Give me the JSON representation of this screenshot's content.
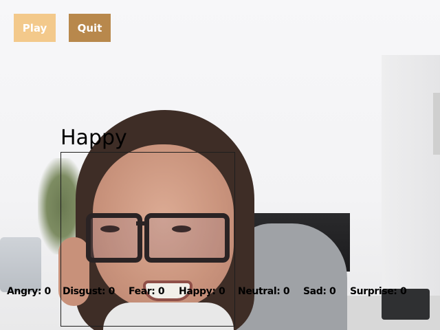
{
  "colors": {
    "play_button_bg": "#f3c98b",
    "quit_button_bg": "#b8884c",
    "button_text": "#ffffff",
    "face_box_border": "#1e1e1e",
    "label_text": "#000000"
  },
  "controls": {
    "play_label": "Play",
    "quit_label": "Quit"
  },
  "detection": {
    "emotion_label": "Happy"
  },
  "emotion_counts": [
    {
      "text": "Angry: 0"
    },
    {
      "text": "Disgust: 0"
    },
    {
      "text": "Fear: 0"
    },
    {
      "text": "Happy: 0"
    },
    {
      "text": "Neutral: 0"
    },
    {
      "text": "Sad: 0"
    },
    {
      "text": "Surprise: 0"
    }
  ]
}
